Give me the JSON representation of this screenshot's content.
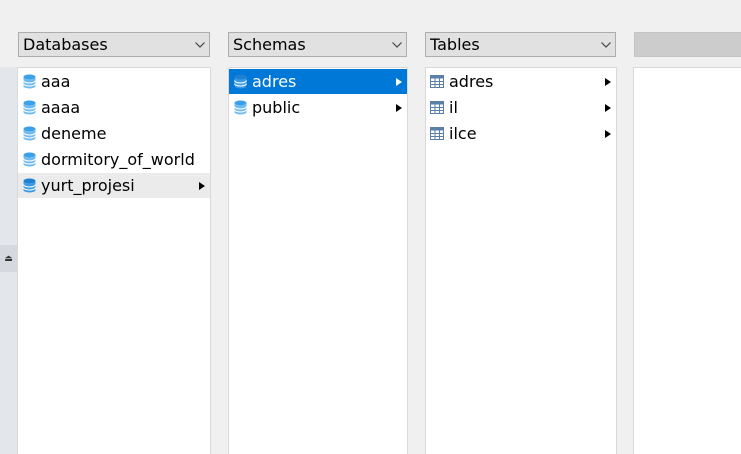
{
  "columns": {
    "databases": {
      "header": "Databases",
      "items": [
        {
          "label": "aaa"
        },
        {
          "label": "aaaa"
        },
        {
          "label": "deneme"
        },
        {
          "label": "dormitory_of_world"
        },
        {
          "label": "yurt_projesi"
        }
      ]
    },
    "schemas": {
      "header": "Schemas",
      "items": [
        {
          "label": "adres"
        },
        {
          "label": "public"
        }
      ]
    },
    "tables": {
      "header": "Tables",
      "items": [
        {
          "label": "adres"
        },
        {
          "label": "il"
        },
        {
          "label": "ilce"
        }
      ]
    },
    "details": {
      "header": ""
    }
  },
  "state": {
    "hovered_database": "yurt_projesi",
    "selected_schema": "adres"
  },
  "colors": {
    "selection": "#0078d7",
    "db_icon": "#3aa0e8",
    "db_icon_active": "#1f7fd0",
    "table_icon": "#5a7fa8"
  },
  "icons": {
    "database": "database-icon",
    "schema": "schema-icon",
    "table": "table-icon",
    "dropdown": "chevron-down-icon",
    "submenu": "caret-right-icon"
  }
}
